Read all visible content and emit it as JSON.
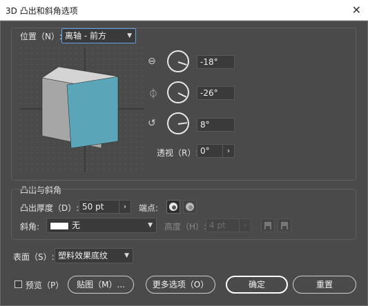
{
  "window": {
    "title": "3D 凸出和斜角选项",
    "close_glyph": "✕"
  },
  "position": {
    "label": "位置（N）:",
    "selected": "离轴 - 前方",
    "x_rotation": "-18°",
    "y_rotation": "-26°",
    "z_rotation": "8°",
    "perspective_label": "透视（R）:",
    "perspective_value": "0°"
  },
  "cube_colors": {
    "front": "#5aa6b8",
    "side": "#a6a6a6",
    "top": "#d4d4d4"
  },
  "extrude": {
    "section_label": "凸出与斜角",
    "depth_label": "凸出厚度（D）:",
    "depth_value": "50 pt",
    "cap_label": "端点:",
    "bevel_label": "斜角:",
    "bevel_value": "无",
    "height_label": "高度（H）:",
    "height_value": "4 pt"
  },
  "surface": {
    "label": "表面（S）:",
    "value": "塑料效果底纹"
  },
  "footer": {
    "preview_label": "预览（P）",
    "map_art_label": "贴图（M）...",
    "more_options_label": "更多选项（O）",
    "ok_label": "确定",
    "reset_label": "重置"
  }
}
